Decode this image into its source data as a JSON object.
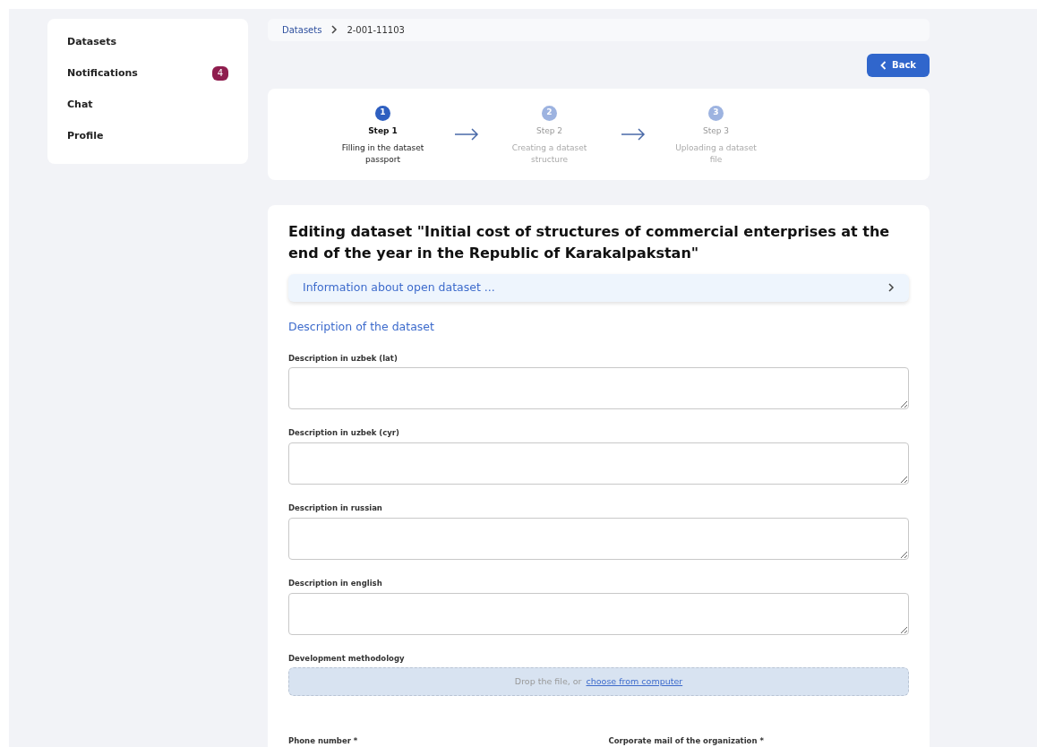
{
  "sidebar": {
    "items": [
      {
        "label": "Datasets"
      },
      {
        "label": "Notifications",
        "badge": "4"
      },
      {
        "label": "Chat"
      },
      {
        "label": "Profile"
      }
    ]
  },
  "breadcrumb": [
    {
      "label": "Datasets"
    },
    {
      "label": "2-001-11103"
    }
  ],
  "back_button": "Back",
  "steps": [
    {
      "number": "1",
      "title": "Step 1",
      "description": "Filling in the dataset passport",
      "selected": true
    },
    {
      "number": "2",
      "title": "Step 2",
      "description": "Creating a dataset structure",
      "selected": false
    },
    {
      "number": "3",
      "title": "Step 3",
      "description": "Uploading a dataset file",
      "selected": false
    }
  ],
  "form": {
    "title": "Editing dataset \"Initial cost of structures of commercial enterprises at the end of the year in the Republic of Karakalpakstan\"",
    "accordion": {
      "label": "Information about open dataset ...",
      "expanded": false
    },
    "section": "Description of the dataset",
    "fields": [
      {
        "label": "Description in uzbek (lat)"
      },
      {
        "label": "Description in uzbek (cyr)"
      },
      {
        "label": "Description in russian"
      },
      {
        "label": "Description in english"
      }
    ],
    "upload": {
      "label": "Development methodology",
      "hint": "Drop the file, or",
      "link": "choose from computer"
    },
    "bottom_fields": [
      {
        "label": "Phone number *"
      },
      {
        "label": "Corporate mail of the organization *"
      }
    ]
  }
}
